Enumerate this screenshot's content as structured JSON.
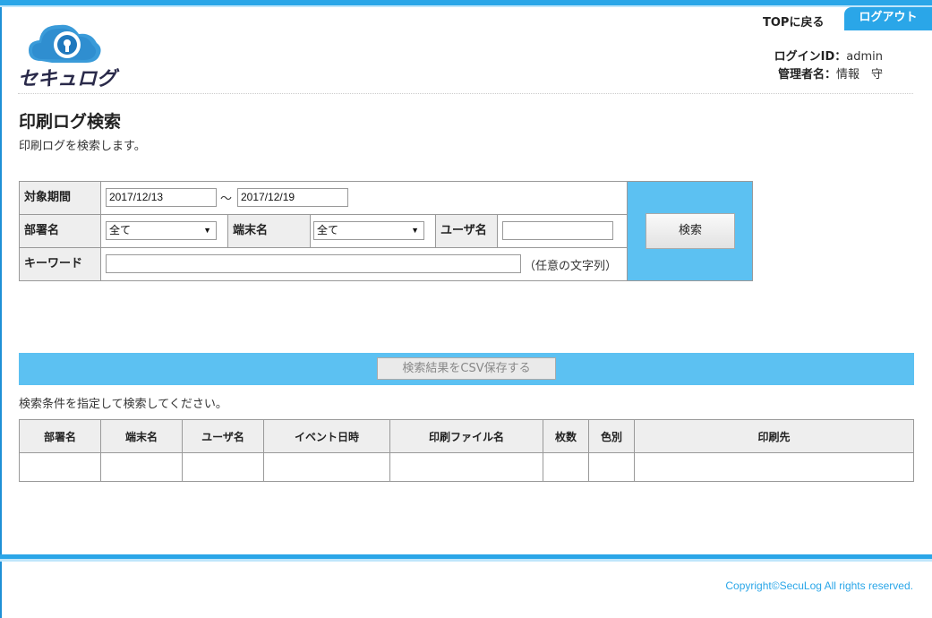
{
  "header": {
    "logo_text": "セキュログ",
    "top_link": "TOPに戻る",
    "logout": "ログアウト",
    "login_id_label": "ログインID：",
    "login_id_value": "admin",
    "admin_label": "管理者名：",
    "admin_value": "情報　守"
  },
  "page": {
    "title": "印刷ログ検索",
    "description": "印刷ログを検索します。"
  },
  "search": {
    "period_label": "対象期間",
    "date_from": "2017/12/13",
    "tilde": "～",
    "date_to": "2017/12/19",
    "dept_label": "部署名",
    "dept_value": "全て",
    "terminal_label": "端末名",
    "terminal_value": "全て",
    "user_label": "ユーザ名",
    "user_value": "",
    "keyword_label": "キーワード",
    "keyword_value": "",
    "keyword_hint": "（任意の文字列）",
    "search_button": "検索"
  },
  "csv_button": "検索結果をCSV保存する",
  "result_message": "検索条件を指定して検索してください。",
  "table": {
    "headers": [
      "部署名",
      "端末名",
      "ユーザ名",
      "イベント日時",
      "印刷ファイル名",
      "枚数",
      "色別",
      "印刷先"
    ]
  },
  "footer": {
    "copyright": "Copyright©SecuLog All rights reserved."
  },
  "colors": {
    "accent": "#2aa6e8",
    "panel": "#5cc1f2"
  }
}
